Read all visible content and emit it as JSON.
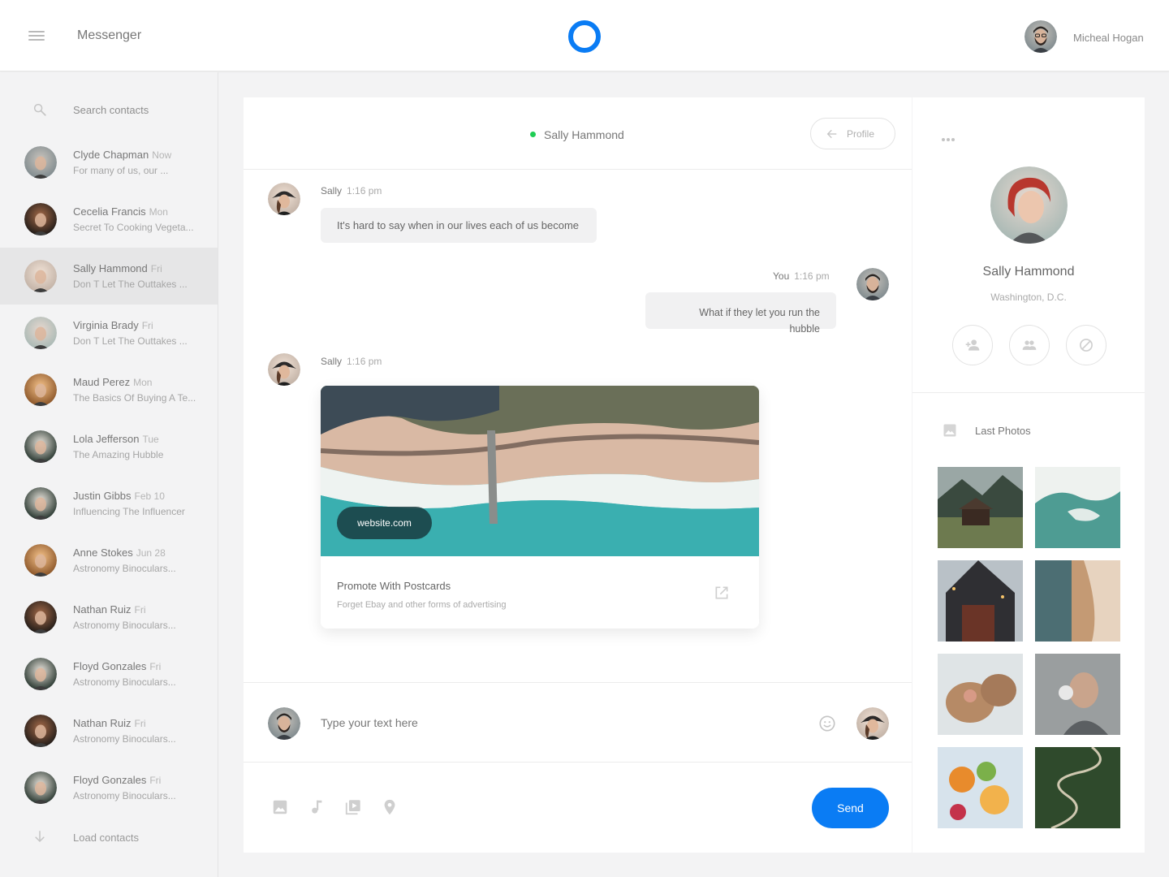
{
  "header": {
    "app_title": "Messenger",
    "user_name": "Micheal Hogan"
  },
  "sidebar": {
    "search_placeholder": "Search contacts",
    "contacts": [
      {
        "name": "Clyde Chapman",
        "time": "Now",
        "preview": "For many of us, our ..."
      },
      {
        "name": "Cecelia Francis",
        "time": "Mon",
        "preview": "Secret To Cooking Vegeta..."
      },
      {
        "name": "Sally Hammond",
        "time": "Fri",
        "preview": "Don T Let The Outtakes ..."
      },
      {
        "name": "Virginia Brady",
        "time": "Fri",
        "preview": "Don T Let The Outtakes ..."
      },
      {
        "name": "Maud Perez",
        "time": "Mon",
        "preview": "The Basics Of Buying A Te..."
      },
      {
        "name": "Lola Jefferson",
        "time": "Tue",
        "preview": "The Amazing Hubble"
      },
      {
        "name": "Justin Gibbs",
        "time": "Feb 10",
        "preview": "Influencing The Influencer"
      },
      {
        "name": "Anne Stokes",
        "time": "Jun 28",
        "preview": "Astronomy Binoculars..."
      },
      {
        "name": "Nathan Ruiz",
        "time": "Fri",
        "preview": "Astronomy Binoculars..."
      },
      {
        "name": "Floyd Gonzales",
        "time": "Fri",
        "preview": "Astronomy Binoculars..."
      },
      {
        "name": "Nathan Ruiz",
        "time": "Fri",
        "preview": "Astronomy Binoculars..."
      },
      {
        "name": "Floyd Gonzales",
        "time": "Fri",
        "preview": "Astronomy Binoculars..."
      }
    ],
    "active_index": 2,
    "load_label": "Load contacts"
  },
  "chat": {
    "contact_name": "Sally Hammond",
    "status_color": "#1fcd54",
    "profile_button": "Profile",
    "messages": [
      {
        "sender": "Sally",
        "time": "1:16 pm",
        "text": "It's hard to say when in our lives each of us become"
      },
      {
        "sender": "You",
        "time": "1:16 pm",
        "text_line1": "What if they let you run the",
        "text_line2": "hubble"
      },
      {
        "sender": "Sally",
        "time": "1:16 pm"
      }
    ],
    "link_card": {
      "domain": "website.com",
      "title": "Promote With Postcards",
      "subtitle": "Forget Ebay and other forms of advertising"
    },
    "compose_placeholder": "Type your text here",
    "send_label": "Send",
    "accent_color": "#0a7cf4"
  },
  "profile_panel": {
    "name": "Sally Hammond",
    "location": "Washington, D.C.",
    "photos_label": "Last Photos"
  }
}
